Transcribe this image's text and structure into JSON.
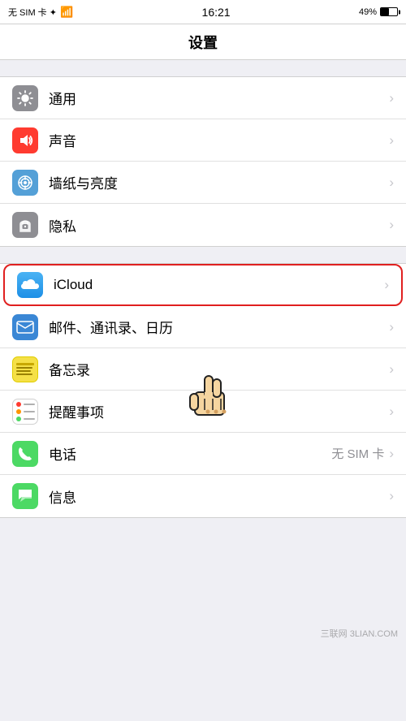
{
  "statusBar": {
    "left": "无 SIM 卡  ✦",
    "time": "16:21",
    "battery": "49%"
  },
  "navBar": {
    "title": "设置"
  },
  "sections": [
    {
      "id": "general",
      "rows": [
        {
          "id": "general",
          "label": "通用",
          "icon": "gear",
          "iconColor": "gray",
          "value": ""
        },
        {
          "id": "sound",
          "label": "声音",
          "icon": "sound",
          "iconColor": "red",
          "value": ""
        },
        {
          "id": "wallpaper",
          "label": "墙纸与亮度",
          "icon": "wallpaper",
          "iconColor": "blue-light",
          "value": ""
        },
        {
          "id": "privacy",
          "label": "隐私",
          "icon": "privacy",
          "iconColor": "gray2",
          "value": ""
        }
      ]
    },
    {
      "id": "accounts",
      "rows": [
        {
          "id": "icloud",
          "label": "iCloud",
          "icon": "icloud",
          "iconColor": "icloud",
          "value": "",
          "highlighted": true
        },
        {
          "id": "mail",
          "label": "邮件、通讯录、日历",
          "icon": "mail",
          "iconColor": "mail",
          "value": ""
        },
        {
          "id": "notes",
          "label": "备忘录",
          "icon": "notes",
          "iconColor": "notes",
          "value": ""
        },
        {
          "id": "reminders",
          "label": "提醒事项",
          "icon": "reminders",
          "iconColor": "reminders",
          "value": ""
        },
        {
          "id": "phone",
          "label": "电话",
          "icon": "phone",
          "iconColor": "phone",
          "value": "无 SIM 卡"
        },
        {
          "id": "messages",
          "label": "信息",
          "icon": "messages",
          "iconColor": "messages",
          "value": ""
        }
      ]
    }
  ],
  "watermark": "三联网 3LIAN.COM"
}
